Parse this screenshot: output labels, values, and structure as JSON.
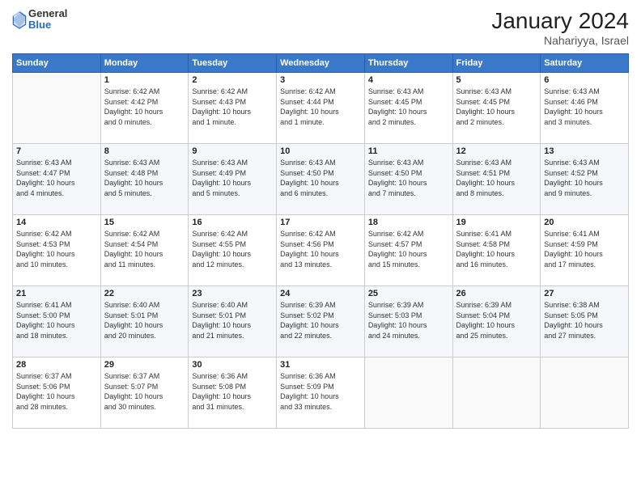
{
  "header": {
    "logo_general": "General",
    "logo_blue": "Blue",
    "month_year": "January 2024",
    "location": "Nahariyya, Israel"
  },
  "weekdays": [
    "Sunday",
    "Monday",
    "Tuesday",
    "Wednesday",
    "Thursday",
    "Friday",
    "Saturday"
  ],
  "weeks": [
    [
      {
        "day": "",
        "info": ""
      },
      {
        "day": "1",
        "info": "Sunrise: 6:42 AM\nSunset: 4:42 PM\nDaylight: 10 hours\nand 0 minutes."
      },
      {
        "day": "2",
        "info": "Sunrise: 6:42 AM\nSunset: 4:43 PM\nDaylight: 10 hours\nand 1 minute."
      },
      {
        "day": "3",
        "info": "Sunrise: 6:42 AM\nSunset: 4:44 PM\nDaylight: 10 hours\nand 1 minute."
      },
      {
        "day": "4",
        "info": "Sunrise: 6:43 AM\nSunset: 4:45 PM\nDaylight: 10 hours\nand 2 minutes."
      },
      {
        "day": "5",
        "info": "Sunrise: 6:43 AM\nSunset: 4:45 PM\nDaylight: 10 hours\nand 2 minutes."
      },
      {
        "day": "6",
        "info": "Sunrise: 6:43 AM\nSunset: 4:46 PM\nDaylight: 10 hours\nand 3 minutes."
      }
    ],
    [
      {
        "day": "7",
        "info": "Sunrise: 6:43 AM\nSunset: 4:47 PM\nDaylight: 10 hours\nand 4 minutes."
      },
      {
        "day": "8",
        "info": "Sunrise: 6:43 AM\nSunset: 4:48 PM\nDaylight: 10 hours\nand 5 minutes."
      },
      {
        "day": "9",
        "info": "Sunrise: 6:43 AM\nSunset: 4:49 PM\nDaylight: 10 hours\nand 5 minutes."
      },
      {
        "day": "10",
        "info": "Sunrise: 6:43 AM\nSunset: 4:50 PM\nDaylight: 10 hours\nand 6 minutes."
      },
      {
        "day": "11",
        "info": "Sunrise: 6:43 AM\nSunset: 4:50 PM\nDaylight: 10 hours\nand 7 minutes."
      },
      {
        "day": "12",
        "info": "Sunrise: 6:43 AM\nSunset: 4:51 PM\nDaylight: 10 hours\nand 8 minutes."
      },
      {
        "day": "13",
        "info": "Sunrise: 6:43 AM\nSunset: 4:52 PM\nDaylight: 10 hours\nand 9 minutes."
      }
    ],
    [
      {
        "day": "14",
        "info": "Sunrise: 6:42 AM\nSunset: 4:53 PM\nDaylight: 10 hours\nand 10 minutes."
      },
      {
        "day": "15",
        "info": "Sunrise: 6:42 AM\nSunset: 4:54 PM\nDaylight: 10 hours\nand 11 minutes."
      },
      {
        "day": "16",
        "info": "Sunrise: 6:42 AM\nSunset: 4:55 PM\nDaylight: 10 hours\nand 12 minutes."
      },
      {
        "day": "17",
        "info": "Sunrise: 6:42 AM\nSunset: 4:56 PM\nDaylight: 10 hours\nand 13 minutes."
      },
      {
        "day": "18",
        "info": "Sunrise: 6:42 AM\nSunset: 4:57 PM\nDaylight: 10 hours\nand 15 minutes."
      },
      {
        "day": "19",
        "info": "Sunrise: 6:41 AM\nSunset: 4:58 PM\nDaylight: 10 hours\nand 16 minutes."
      },
      {
        "day": "20",
        "info": "Sunrise: 6:41 AM\nSunset: 4:59 PM\nDaylight: 10 hours\nand 17 minutes."
      }
    ],
    [
      {
        "day": "21",
        "info": "Sunrise: 6:41 AM\nSunset: 5:00 PM\nDaylight: 10 hours\nand 18 minutes."
      },
      {
        "day": "22",
        "info": "Sunrise: 6:40 AM\nSunset: 5:01 PM\nDaylight: 10 hours\nand 20 minutes."
      },
      {
        "day": "23",
        "info": "Sunrise: 6:40 AM\nSunset: 5:01 PM\nDaylight: 10 hours\nand 21 minutes."
      },
      {
        "day": "24",
        "info": "Sunrise: 6:39 AM\nSunset: 5:02 PM\nDaylight: 10 hours\nand 22 minutes."
      },
      {
        "day": "25",
        "info": "Sunrise: 6:39 AM\nSunset: 5:03 PM\nDaylight: 10 hours\nand 24 minutes."
      },
      {
        "day": "26",
        "info": "Sunrise: 6:39 AM\nSunset: 5:04 PM\nDaylight: 10 hours\nand 25 minutes."
      },
      {
        "day": "27",
        "info": "Sunrise: 6:38 AM\nSunset: 5:05 PM\nDaylight: 10 hours\nand 27 minutes."
      }
    ],
    [
      {
        "day": "28",
        "info": "Sunrise: 6:37 AM\nSunset: 5:06 PM\nDaylight: 10 hours\nand 28 minutes."
      },
      {
        "day": "29",
        "info": "Sunrise: 6:37 AM\nSunset: 5:07 PM\nDaylight: 10 hours\nand 30 minutes."
      },
      {
        "day": "30",
        "info": "Sunrise: 6:36 AM\nSunset: 5:08 PM\nDaylight: 10 hours\nand 31 minutes."
      },
      {
        "day": "31",
        "info": "Sunrise: 6:36 AM\nSunset: 5:09 PM\nDaylight: 10 hours\nand 33 minutes."
      },
      {
        "day": "",
        "info": ""
      },
      {
        "day": "",
        "info": ""
      },
      {
        "day": "",
        "info": ""
      }
    ]
  ]
}
